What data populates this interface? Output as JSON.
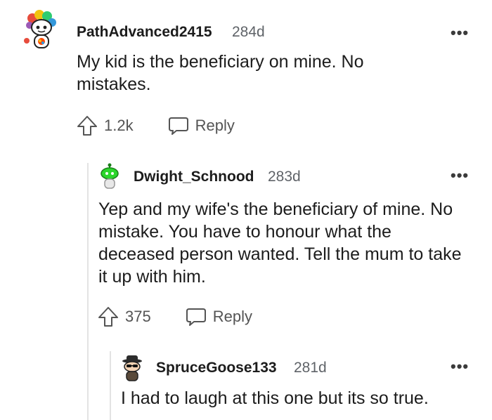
{
  "comments": [
    {
      "username": "PathAdvanced2415",
      "age": "284d",
      "body": "My kid is the beneficiary on mine. No mistakes.",
      "votes": "1.2k",
      "reply_label": "Reply",
      "avatar": "snoo-rainbow-hair-avatar",
      "more_icon": "more-options-icon"
    },
    {
      "username": "Dwight_Schnood",
      "age": "283d",
      "body": "Yep and my wife's the beneficiary of mine. No mistake. You have to honour what the deceased person wanted. Tell the mum to take it up with him.",
      "votes": "375",
      "reply_label": "Reply",
      "avatar": "snoo-green-avatar",
      "more_icon": "more-options-icon"
    },
    {
      "username": "SpruceGoose133",
      "age": "281d",
      "body": "I had to laugh at this one but its so true.",
      "avatar": "snoo-hat-sunglasses-avatar",
      "more_icon": "more-options-icon"
    }
  ],
  "more_label": "•••",
  "colors": {
    "text": "#1c1c1c",
    "meta": "#5f6368",
    "action": "#545454",
    "thread_line": "#e3e3e3"
  }
}
